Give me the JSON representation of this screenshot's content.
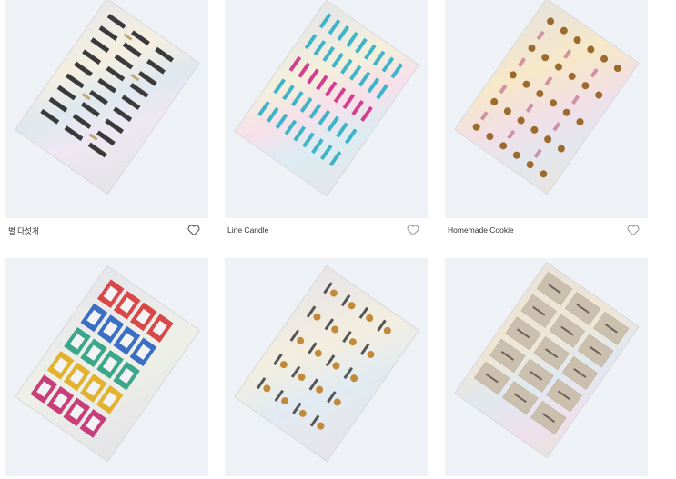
{
  "products": [
    {
      "title": "별 다섯개",
      "theme": "thankyou"
    },
    {
      "title": "Line Candle",
      "theme": "candle"
    },
    {
      "title": "Homemade Cookie",
      "theme": "cookie"
    },
    {
      "title": "",
      "theme": "rainbow"
    },
    {
      "title": "",
      "theme": "coffee"
    },
    {
      "title": "",
      "theme": "beige"
    }
  ],
  "colors": {
    "thumb_bg": "#eef1f5",
    "heart": "#8a8a8a",
    "text": "#333333"
  },
  "icons": {
    "favorite": "heart-outline-icon"
  }
}
